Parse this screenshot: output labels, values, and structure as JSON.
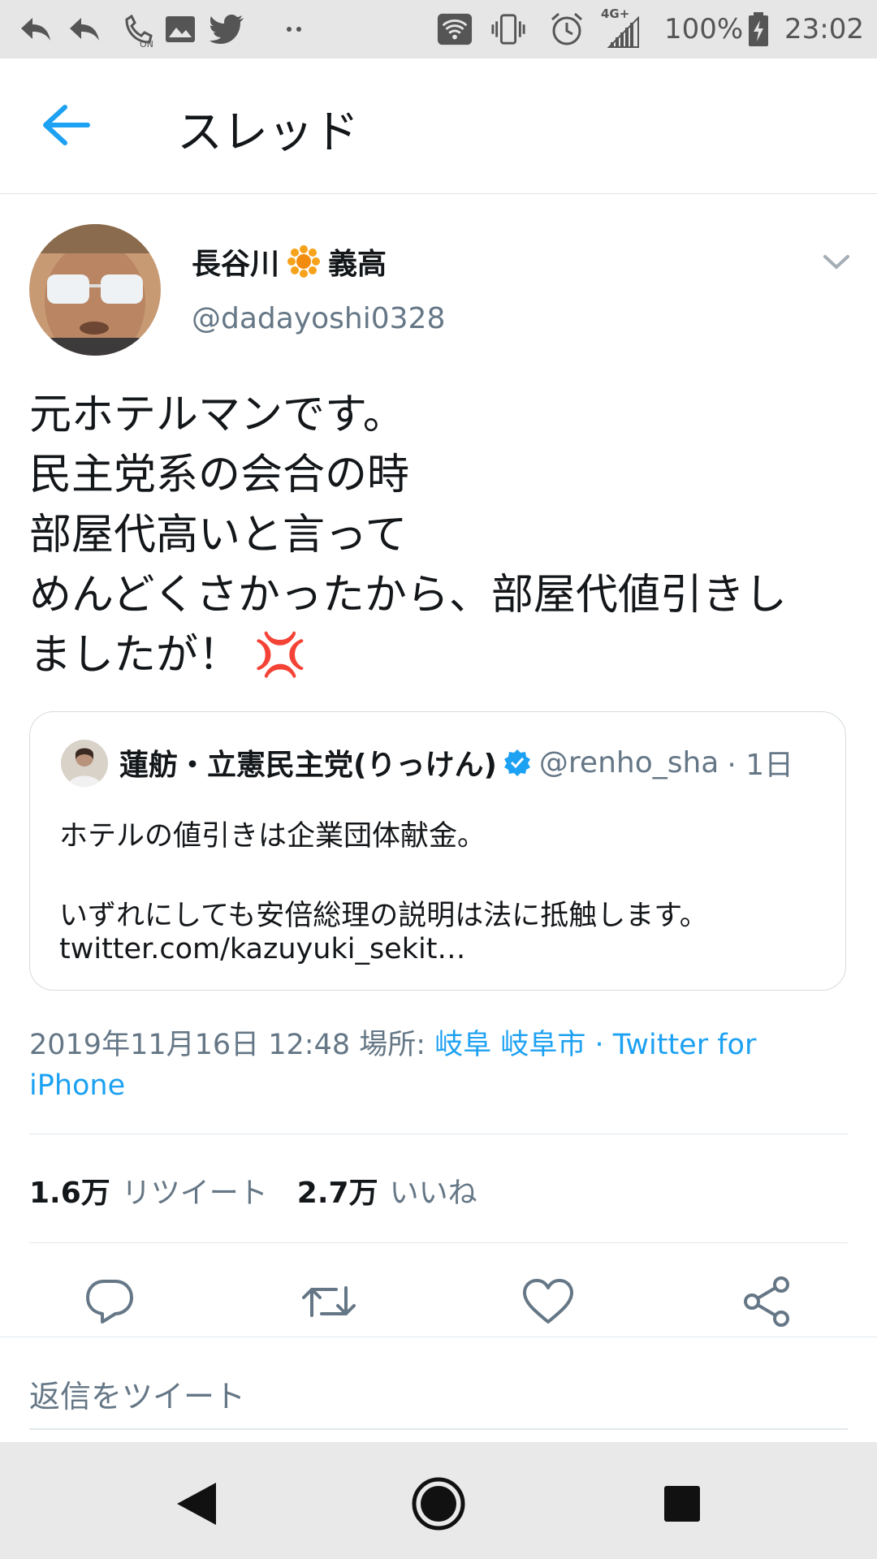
{
  "status_bar": {
    "icons": [
      "reply-arrow-icon",
      "reply-arrow-icon",
      "wifi-calling-icon",
      "image-icon",
      "twitter-bird-icon",
      "more-dots-icon",
      "wifi-icon",
      "vibrate-icon",
      "alarm-icon",
      "signal-4g-icon",
      "battery-charging-icon"
    ],
    "network": "4G+",
    "battery": "100%",
    "time": "23:02"
  },
  "header": {
    "title": "スレッド"
  },
  "tweet": {
    "name_part1": "長谷川",
    "name_part2": "義高",
    "handle": "@dadayoshi0328",
    "body": "元ホテルマンです。\n民主党系の会合の時\n部屋代高いと言って\nめんどくさかったから、部屋代値引きし\nましたが！ 💢",
    "quote": {
      "name": "蓮舫・立憲民主党(りっけん)",
      "handle": "@renho_sha",
      "time": "· 1日",
      "text1": "ホテルの値引きは企業団体献金。",
      "text2": "いずれにしても安倍総理の説明は法に抵触します。",
      "link": "twitter.com/kazuyuki_sekit…"
    },
    "meta": {
      "datetime": "2019年11月16日 12:48",
      "place_label": "場所:",
      "place": "岐阜 岐阜市",
      "sep": "·",
      "client": "Twitter for iPhone"
    },
    "stats": {
      "retweet_count": "1.6万",
      "retweet_label": "リツイート",
      "like_count": "2.7万",
      "like_label": "いいね"
    }
  },
  "reply": {
    "placeholder": "返信をツイート"
  },
  "colors": {
    "accent": "#1da1f2",
    "secondary_text": "#657786",
    "text": "#14171a"
  }
}
